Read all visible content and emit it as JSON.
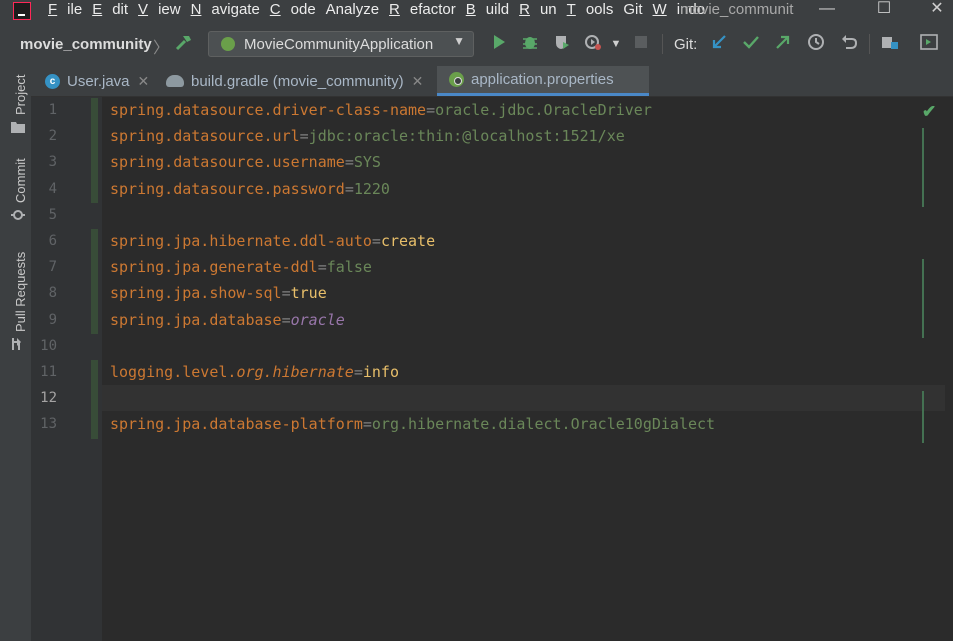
{
  "window": {
    "title": "movie_communit",
    "minimize": "—",
    "maximize": "☐",
    "close": "✕"
  },
  "menu": {
    "items": [
      {
        "label": "File",
        "mnemonic": "F",
        "rest": "ile"
      },
      {
        "label": "Edit",
        "mnemonic": "E",
        "rest": "dit"
      },
      {
        "label": "View",
        "mnemonic": "V",
        "rest": "iew"
      },
      {
        "label": "Navigate",
        "mnemonic": "N",
        "rest": "avigate"
      },
      {
        "label": "Code",
        "mnemonic": "C",
        "rest": "ode"
      },
      {
        "label": "Analyze",
        "mnemonic": "",
        "rest": "Analyze"
      },
      {
        "label": "Refactor",
        "mnemonic": "R",
        "rest": "efactor"
      },
      {
        "label": "Build",
        "mnemonic": "B",
        "rest": "uild"
      },
      {
        "label": "Run",
        "mnemonic": "R",
        "rest": "un"
      },
      {
        "label": "Tools",
        "mnemonic": "T",
        "rest": "ools"
      },
      {
        "label": "Git",
        "mnemonic": "",
        "rest": "Git"
      },
      {
        "label": "Windo",
        "mnemonic": "W",
        "rest": "indo"
      }
    ]
  },
  "toolbar": {
    "project_name": "movie_community",
    "run_config": "MovieCommunityApplication",
    "git_label": "Git:"
  },
  "tool_strip": {
    "project": "Project",
    "commit": "Commit",
    "pull_requests": "Pull Requests"
  },
  "tabs": [
    {
      "label": "User.java",
      "icon": "c-class-icon",
      "active": false
    },
    {
      "label": "build.gradle (movie_community)",
      "icon": "gradle-elephant-icon",
      "active": false
    },
    {
      "label": "application.properties",
      "icon": "spring-properties-icon",
      "active": true
    }
  ],
  "editor": {
    "current_line": 12,
    "lines": [
      {
        "num": "1",
        "key": "spring.datasource.driver-class-name",
        "eq": "=",
        "value": "oracle.jdbc.OracleDriver",
        "vstyle": "v"
      },
      {
        "num": "2",
        "key": "spring.datasource.url",
        "eq": "=",
        "value": "jdbc:oracle:thin:@localhost:1521/xe",
        "vstyle": "v"
      },
      {
        "num": "3",
        "key": "spring.datasource.username",
        "eq": "=",
        "value": "SYS",
        "vstyle": "v"
      },
      {
        "num": "4",
        "key": "spring.datasource.password",
        "eq": "=",
        "value": "1220",
        "vstyle": "v"
      },
      {
        "num": "5",
        "key": "",
        "eq": "",
        "value": "",
        "vstyle": "v"
      },
      {
        "num": "6",
        "key": "spring.jpa.hibernate.ddl-auto",
        "eq": "=",
        "value": "create",
        "vstyle": "vb"
      },
      {
        "num": "7",
        "key": "spring.jpa.generate-ddl",
        "eq": "=",
        "value": "false",
        "vstyle": "v"
      },
      {
        "num": "8",
        "key": "spring.jpa.show-sql",
        "eq": "=",
        "value": "true",
        "vstyle": "vb"
      },
      {
        "num": "9",
        "key": "spring.jpa.database",
        "eq": "=",
        "value": "oracle",
        "vstyle": "it"
      },
      {
        "num": "10",
        "key": "",
        "eq": "",
        "value": "",
        "vstyle": "v"
      },
      {
        "num": "11",
        "key": "logging.level.",
        "key_italic": "org.hibernate",
        "eq": "=",
        "value": "info",
        "vstyle": "vb"
      },
      {
        "num": "12",
        "key": "",
        "eq": "",
        "value": "",
        "vstyle": "v"
      },
      {
        "num": "13",
        "key": "spring.jpa.database-platform",
        "eq": "=",
        "value": "org.hibernate.dialect.Oracle10gDialect",
        "vstyle": "v"
      }
    ]
  },
  "colors": {
    "key": "#cc7832",
    "string_value": "#6a8759",
    "keyword_value": "#e8bf6a",
    "enum_value": "#9876aa",
    "accent_tab": "#4a88c7",
    "ok_check": "#59a869"
  },
  "inspection_status": "ok-check-icon"
}
